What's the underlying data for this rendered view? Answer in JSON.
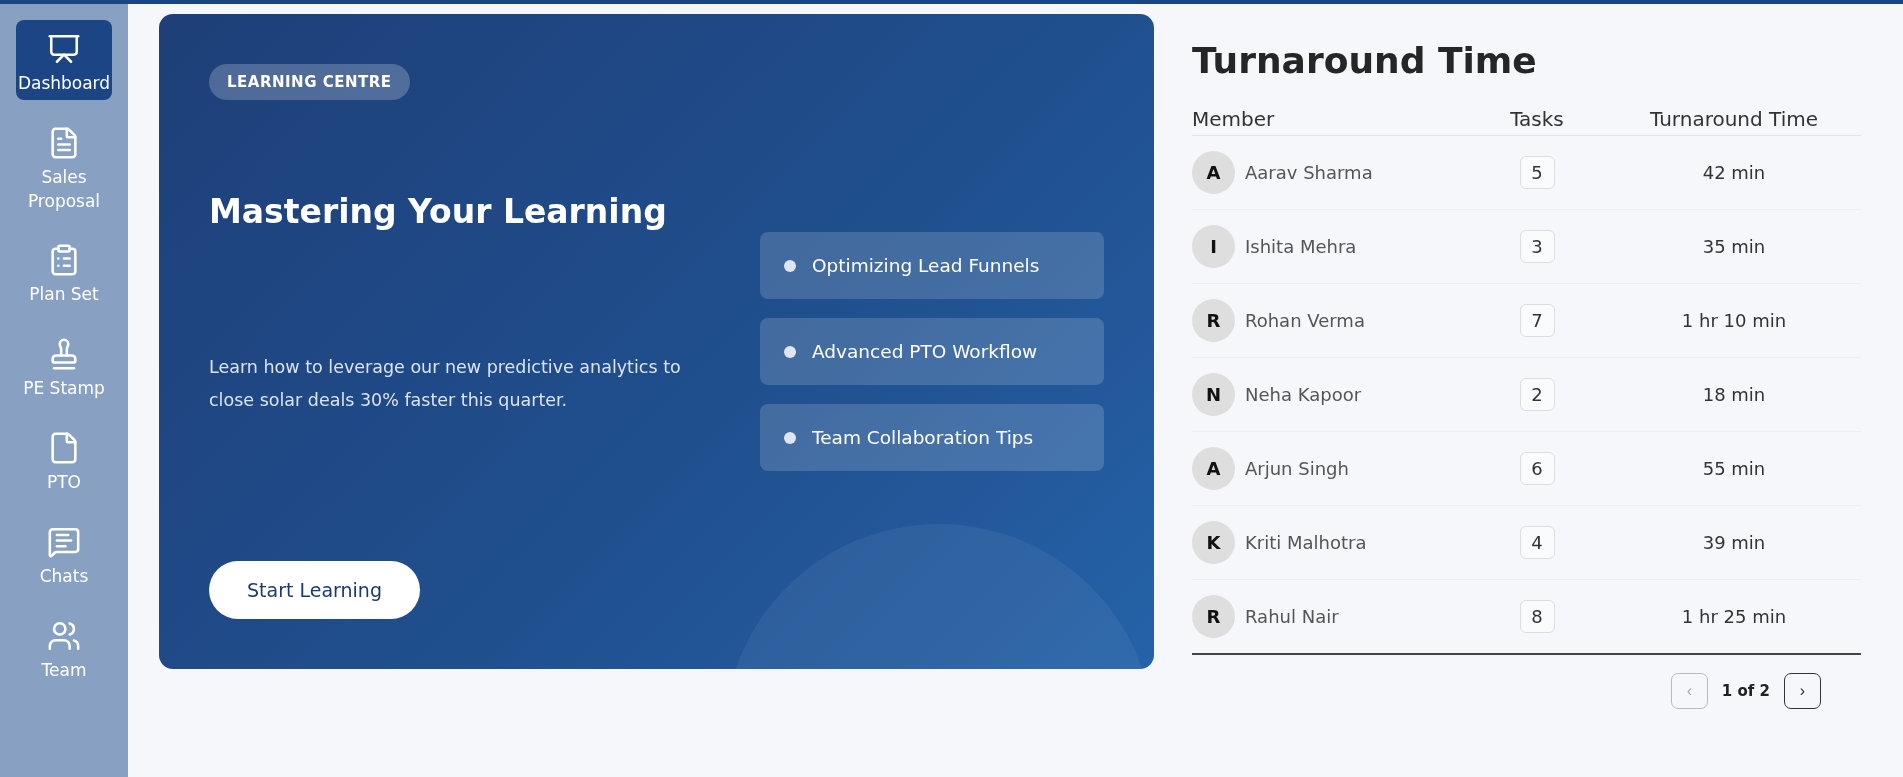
{
  "sidebar": {
    "items": [
      {
        "label": "Dashboard",
        "selected": true
      },
      {
        "label": "Sales Proposal",
        "selected": false
      },
      {
        "label": "Plan Set",
        "selected": false
      },
      {
        "label": "PE Stamp",
        "selected": false
      },
      {
        "label": "PTO",
        "selected": false
      },
      {
        "label": "Chats",
        "selected": false
      },
      {
        "label": "Team",
        "selected": false
      }
    ]
  },
  "learning_card": {
    "badge": "LEARNING CENTRE",
    "title": "Mastering Your Learning",
    "description": "Learn how to leverage our new predictive analytics to close solar deals 30% faster this quarter.",
    "button": "Start Learning",
    "topics": [
      "Optimizing Lead Funnels",
      "Advanced PTO Workflow",
      "Team Collaboration Tips"
    ]
  },
  "turnaround": {
    "title": "Turnaround Time",
    "columns": [
      "Member",
      "Tasks",
      "Turnaround Time"
    ],
    "rows": [
      {
        "initial": "A",
        "name": "Aarav Sharma",
        "tasks": "5",
        "time": "42 min"
      },
      {
        "initial": "I",
        "name": "Ishita Mehra",
        "tasks": "3",
        "time": "35 min"
      },
      {
        "initial": "R",
        "name": "Rohan Verma",
        "tasks": "7",
        "time": "1 hr 10 min"
      },
      {
        "initial": "N",
        "name": "Neha Kapoor",
        "tasks": "2",
        "time": "18 min"
      },
      {
        "initial": "A",
        "name": "Arjun Singh",
        "tasks": "6",
        "time": "55 min"
      },
      {
        "initial": "K",
        "name": "Kriti Malhotra",
        "tasks": "4",
        "time": "39 min"
      },
      {
        "initial": "R",
        "name": "Rahul Nair",
        "tasks": "8",
        "time": "1 hr 25 min"
      }
    ],
    "pagination": {
      "prev": {
        "label": "‹",
        "disabled": true
      },
      "page": "1 of 2",
      "next": {
        "label": "›",
        "disabled": false
      }
    }
  }
}
